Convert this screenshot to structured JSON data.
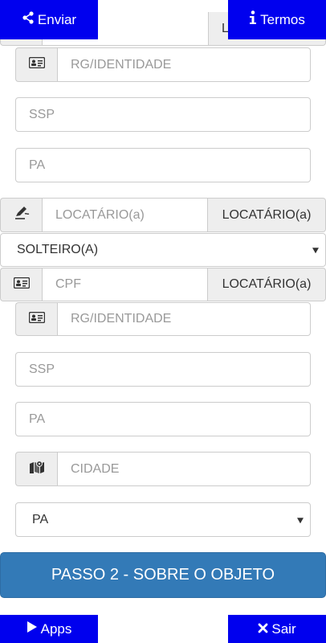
{
  "top_bar": {
    "enviar_label": "Enviar",
    "termos_label": "Termos",
    "partial_field_suffix": "L"
  },
  "tenant1": {
    "rg_placeholder": "RG/IDENTIDADE",
    "ssp_placeholder": "SSP",
    "pa_placeholder": "PA"
  },
  "tenant2": {
    "name_placeholder": "LOCATÁRIO(a)",
    "name_addon": "LOCATÁRIO(a)",
    "marital_status": "SOLTEIRO(A)",
    "cpf_placeholder": "CPF",
    "cpf_addon": "LOCATÁRIO(a)",
    "rg_placeholder": "RG/IDENTIDADE",
    "ssp_placeholder": "SSP",
    "pa_placeholder": "PA",
    "city_placeholder": "CIDADE",
    "state_selected": "PA"
  },
  "step_button": {
    "label": "PASSO 2 - SOBRE O OBJETO"
  },
  "bottom_bar": {
    "apps_label": "Apps",
    "sair_label": "Sair"
  },
  "colors": {
    "nav_button": "#0000ee",
    "step_button": "#337ab7",
    "addon_bg": "#eeeeee",
    "border": "#cccccc"
  },
  "icons": [
    "share-icon",
    "info-icon",
    "id-card-icon",
    "signature-icon",
    "map-icon",
    "play-icon",
    "close-icon"
  ]
}
